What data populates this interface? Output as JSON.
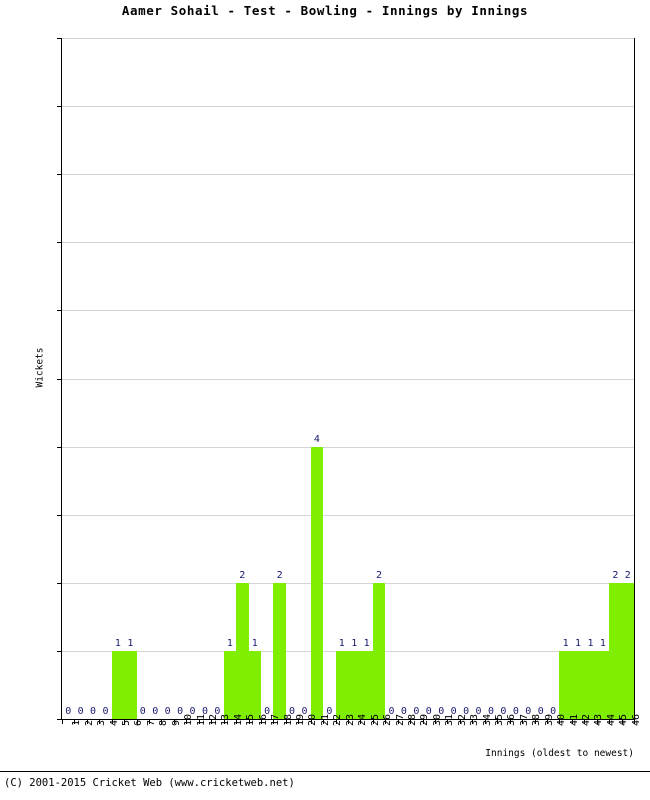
{
  "chart_data": {
    "type": "bar",
    "title": "Aamer Sohail - Test - Bowling - Innings by Innings",
    "xlabel": "Innings (oldest to newest)",
    "ylabel": "Wickets",
    "ylim": [
      0,
      10
    ],
    "yticks": [
      0,
      1,
      2,
      3,
      4,
      5,
      6,
      7,
      8,
      9,
      10
    ],
    "grid": true,
    "legend": null,
    "bar_color": "#80ee00",
    "value_label_color": "#191970",
    "categories": [
      "1",
      "2",
      "3",
      "4",
      "5",
      "6",
      "7",
      "8",
      "9",
      "10",
      "11",
      "12",
      "13",
      "14",
      "15",
      "16",
      "17",
      "18",
      "19",
      "20",
      "21",
      "22",
      "23",
      "24",
      "25",
      "26",
      "27",
      "28",
      "29",
      "30",
      "31",
      "32",
      "33",
      "34",
      "35",
      "36",
      "37",
      "38",
      "39",
      "40",
      "41",
      "42",
      "43",
      "44",
      "45",
      "46"
    ],
    "values": [
      0,
      0,
      0,
      0,
      1,
      1,
      0,
      0,
      0,
      0,
      0,
      0,
      0,
      1,
      2,
      1,
      0,
      2,
      0,
      0,
      4,
      0,
      1,
      1,
      1,
      2,
      0,
      0,
      0,
      0,
      0,
      0,
      0,
      0,
      0,
      0,
      0,
      0,
      0,
      0,
      1,
      1,
      1,
      1,
      2,
      2
    ]
  },
  "footer": {
    "text": "(C) 2001-2015 Cricket Web (www.cricketweb.net)"
  }
}
